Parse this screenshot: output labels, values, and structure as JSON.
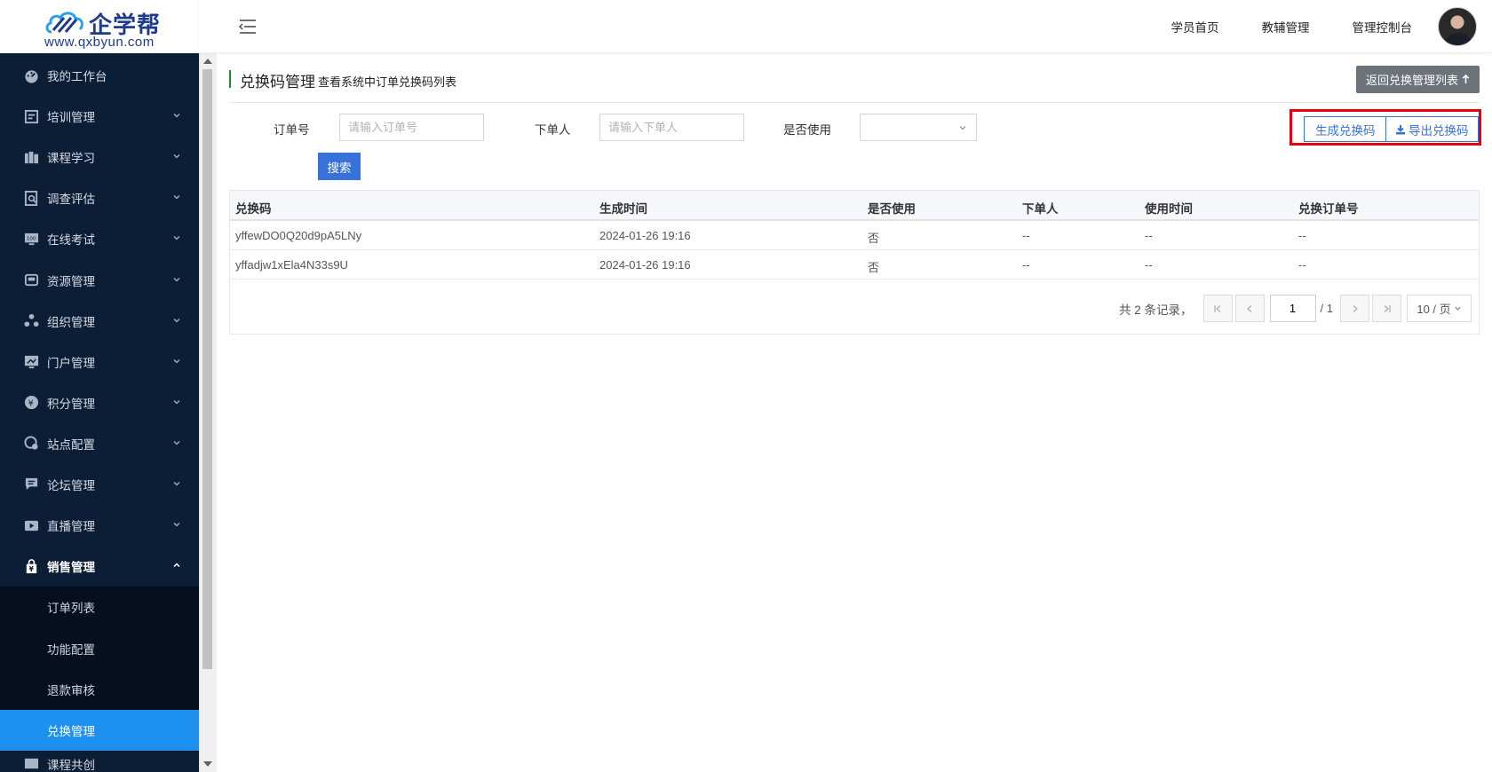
{
  "logo": {
    "cn": "企学帮",
    "en": "www.qxbyun.com"
  },
  "header": {
    "nav": [
      "学员首页",
      "教辅管理",
      "管理控制台"
    ]
  },
  "sidebar": {
    "items": [
      {
        "label": "我的工作台",
        "icon": "dashboard-icon"
      },
      {
        "label": "培训管理",
        "icon": "training-icon"
      },
      {
        "label": "课程学习",
        "icon": "course-icon"
      },
      {
        "label": "调查评估",
        "icon": "survey-icon"
      },
      {
        "label": "在线考试",
        "icon": "exam-icon"
      },
      {
        "label": "资源管理",
        "icon": "resource-icon"
      },
      {
        "label": "组织管理",
        "icon": "org-icon"
      },
      {
        "label": "门户管理",
        "icon": "portal-icon"
      },
      {
        "label": "积分管理",
        "icon": "points-icon"
      },
      {
        "label": "站点配置",
        "icon": "site-icon"
      },
      {
        "label": "论坛管理",
        "icon": "forum-icon"
      },
      {
        "label": "直播管理",
        "icon": "live-icon"
      },
      {
        "label": "销售管理",
        "icon": "sales-icon"
      }
    ],
    "sub_items": [
      "订单列表",
      "功能配置",
      "退款审核",
      "兑换管理"
    ],
    "partial_item": "课程共创"
  },
  "page": {
    "title": "兑换码管理",
    "subtitle": "查看系统中订单兑换码列表",
    "back_label": "返回兑换管理列表"
  },
  "filter": {
    "order_label": "订单号",
    "order_placeholder": "请输入订单号",
    "buyer_label": "下单人",
    "buyer_placeholder": "请输入下单人",
    "used_label": "是否使用",
    "search_label": "搜索",
    "generate_label": "生成兑换码",
    "export_label": "导出兑换码"
  },
  "table": {
    "headers": [
      "兑换码",
      "生成时间",
      "是否使用",
      "下单人",
      "使用时间",
      "兑换订单号"
    ],
    "rows": [
      [
        "yffewDO0Q20d9pA5LNy",
        "2024-01-26 19:16",
        "否",
        "--",
        "--",
        "--"
      ],
      [
        "yffadjw1xEla4N33s9U",
        "2024-01-26 19:16",
        "否",
        "--",
        "--",
        "--"
      ]
    ]
  },
  "pager": {
    "total_text": "共 2 条记录，",
    "current_page": "1",
    "of_text": "/ 1",
    "page_size": "10 / 页"
  },
  "colors": {
    "sidebar_bg": "#0c1e36",
    "active_item": "#1e90f0",
    "primary": "#3872d8",
    "highlight_box": "#e60012"
  }
}
